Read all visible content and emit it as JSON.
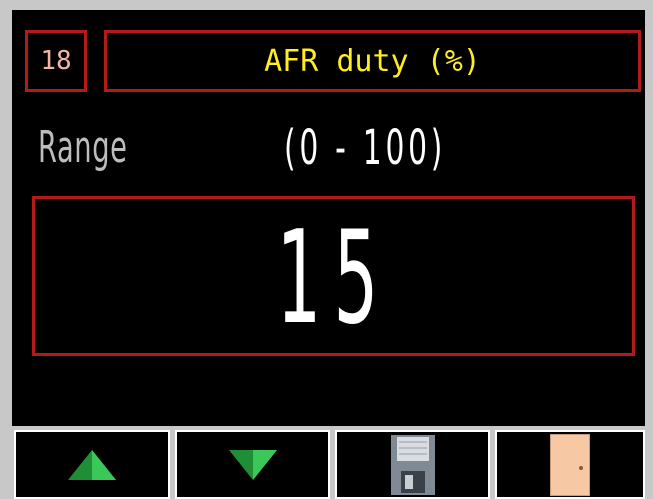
{
  "header": {
    "param_number": "18",
    "title": "AFR duty (%)"
  },
  "range": {
    "label": "Range",
    "value": "(0 - 100)"
  },
  "current_value": "15",
  "buttons": {
    "up_icon": "triangle-up-icon",
    "down_icon": "triangle-down-icon",
    "save_icon": "floppy-disk-icon",
    "exit_icon": "door-icon"
  },
  "colors": {
    "border_red": "#b31b1b",
    "title_yellow": "#ffee22",
    "param_pink": "#f5b5a5",
    "arrow_green": "#2fb44a",
    "door_peach": "#f6c9a4"
  }
}
